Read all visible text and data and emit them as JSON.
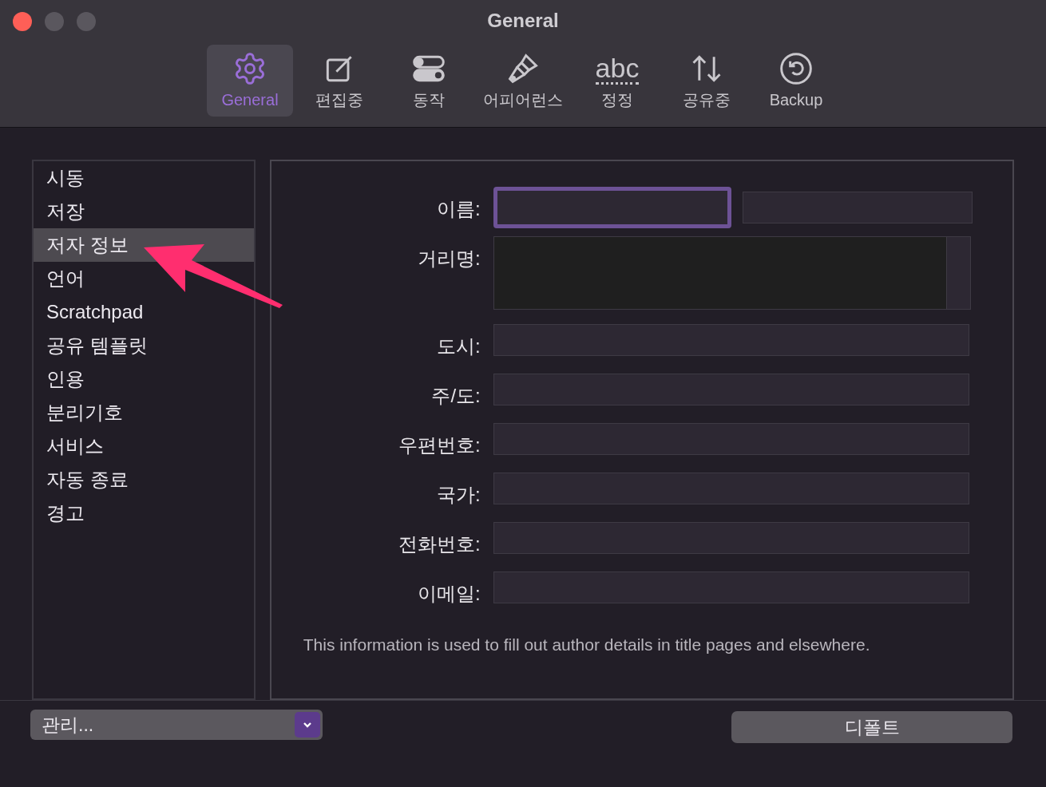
{
  "window": {
    "title": "General"
  },
  "toolbar": [
    {
      "kind": "gear",
      "label": "General",
      "selected": true
    },
    {
      "kind": "pen",
      "label": "편집중",
      "selected": false
    },
    {
      "kind": "toggles",
      "label": "동작",
      "selected": false
    },
    {
      "kind": "brush",
      "label": "어피어런스",
      "selected": false
    },
    {
      "kind": "abc",
      "glyph": "abc",
      "label": "정정",
      "selected": false
    },
    {
      "kind": "arrows",
      "label": "공유중",
      "selected": false
    },
    {
      "kind": "backup",
      "label": "Backup",
      "selected": false
    }
  ],
  "sidebar": {
    "items": [
      {
        "label": "시동",
        "selected": false
      },
      {
        "label": "저장",
        "selected": false
      },
      {
        "label": "저자 정보",
        "selected": true
      },
      {
        "label": "언어",
        "selected": false
      },
      {
        "label": "Scratchpad",
        "selected": false
      },
      {
        "label": "공유 템플릿",
        "selected": false
      },
      {
        "label": "인용",
        "selected": false
      },
      {
        "label": "분리기호",
        "selected": false
      },
      {
        "label": "서비스",
        "selected": false
      },
      {
        "label": "자동 종료",
        "selected": false
      },
      {
        "label": "경고",
        "selected": false
      }
    ]
  },
  "form": {
    "fields": [
      {
        "kind": "pair",
        "label": "이름:",
        "focused": true
      },
      {
        "kind": "area",
        "label": "거리명:"
      },
      {
        "kind": "text",
        "label": "도시:"
      },
      {
        "kind": "text",
        "label": "주/도:"
      },
      {
        "kind": "text",
        "label": "우편번호:"
      },
      {
        "kind": "text",
        "label": "국가:"
      },
      {
        "kind": "text",
        "label": "전화번호:"
      },
      {
        "kind": "text",
        "label": "이메일:"
      }
    ],
    "note": "This information is used to fill out author details in title pages and elsewhere."
  },
  "footer": {
    "popup": "관리...",
    "default_button": "디폴트"
  }
}
